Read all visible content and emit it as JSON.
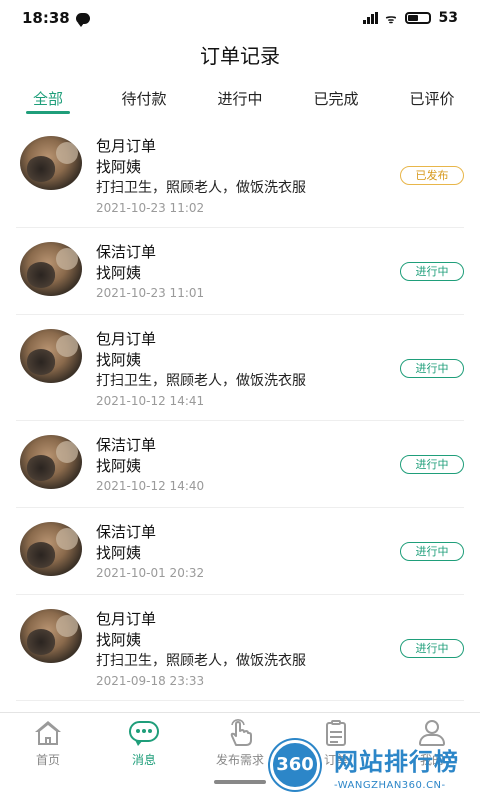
{
  "status_bar": {
    "time": "18:38",
    "network": "ᯤ",
    "battery": "53",
    "battery_level": 0.53
  },
  "header": {
    "title": "订单记录"
  },
  "tabs": [
    {
      "label": "全部",
      "active": true
    },
    {
      "label": "待付款",
      "active": false
    },
    {
      "label": "进行中",
      "active": false
    },
    {
      "label": "已完成",
      "active": false
    },
    {
      "label": "已评价",
      "active": false
    }
  ],
  "orders": [
    {
      "type": "包月订单",
      "who": "找阿姨",
      "desc": "打扫卫生，照顾老人，做饭洗衣服",
      "time": "2021-10-23 11:02",
      "status": "已发布"
    },
    {
      "type": "保洁订单",
      "who": "找阿姨",
      "desc": "",
      "time": "2021-10-23 11:01",
      "status": "进行中"
    },
    {
      "type": "包月订单",
      "who": "找阿姨",
      "desc": "打扫卫生，照顾老人，做饭洗衣服",
      "time": "2021-10-12 14:41",
      "status": "进行中"
    },
    {
      "type": "保洁订单",
      "who": "找阿姨",
      "desc": "",
      "time": "2021-10-12 14:40",
      "status": "进行中"
    },
    {
      "type": "保洁订单",
      "who": "找阿姨",
      "desc": "",
      "time": "2021-10-01 20:32",
      "status": "进行中"
    },
    {
      "type": "包月订单",
      "who": "找阿姨",
      "desc": "打扫卫生，照顾老人，做饭洗衣服",
      "time": "2021-09-18 23:33",
      "status": "进行中"
    }
  ],
  "bottom_nav": [
    {
      "label": "首页",
      "icon": "home-icon",
      "active": false
    },
    {
      "label": "消息",
      "icon": "message-icon",
      "active": true
    },
    {
      "label": "发布需求",
      "icon": "publish-hand-icon",
      "active": false
    },
    {
      "label": "订单",
      "icon": "order-icon",
      "active": false
    },
    {
      "label": "我的",
      "icon": "profile-icon",
      "active": false
    }
  ],
  "watermark": {
    "badge": "360",
    "title": "网站排行榜",
    "subtitle": "-WANGZHAN360.CN-"
  },
  "colors": {
    "accent": "#1f9e7a",
    "published": "#e8b64a",
    "muted": "#9a9a9a"
  }
}
